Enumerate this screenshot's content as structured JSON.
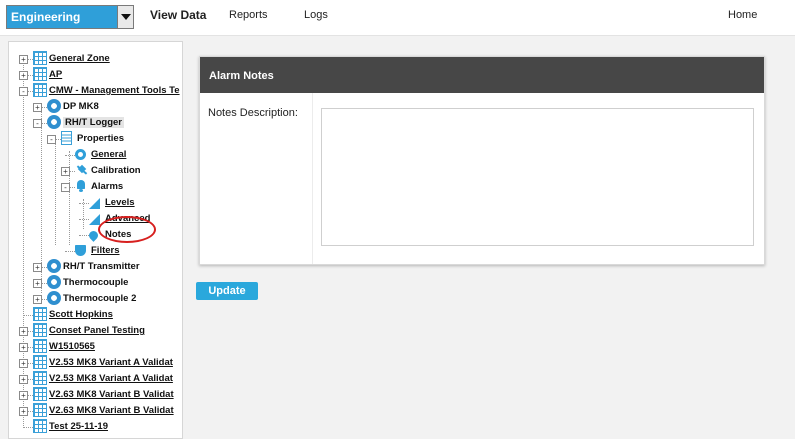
{
  "header": {
    "department_select": "Engineering",
    "nav": [
      "View Data",
      "Reports",
      "Logs"
    ],
    "home": "Home"
  },
  "tree": [
    {
      "label": "General Zone",
      "icon": "grid-icon"
    },
    {
      "label": "AP",
      "icon": "grid-icon"
    },
    {
      "label": "CMW - Management Tools Te",
      "icon": "grid-icon"
    },
    {
      "label": "DP MK8",
      "icon": "gear-icon"
    },
    {
      "label": "RH/T Logger",
      "icon": "gear-icon"
    },
    {
      "label": "Properties",
      "icon": "page-icon"
    },
    {
      "label": "General",
      "icon": "ring-icon"
    },
    {
      "label": "Calibration",
      "icon": "satellite-icon"
    },
    {
      "label": "Alarms",
      "icon": "bell-icon"
    },
    {
      "label": "Levels",
      "icon": "triangle-icon"
    },
    {
      "label": "Advanced",
      "icon": "triangle-icon"
    },
    {
      "label": "Notes",
      "icon": "drop-icon"
    },
    {
      "label": "Filters",
      "icon": "shield-icon"
    },
    {
      "label": "RH/T Transmitter",
      "icon": "gear-icon"
    },
    {
      "label": "Thermocouple",
      "icon": "gear-icon"
    },
    {
      "label": "Thermocouple 2",
      "icon": "gear-icon"
    },
    {
      "label": "Scott Hopkins",
      "icon": "grid-icon"
    },
    {
      "label": "Conset Panel Testing",
      "icon": "grid-icon"
    },
    {
      "label": "W1510565",
      "icon": "grid-icon"
    },
    {
      "label": "V2.53 MK8 Variant A Validat",
      "icon": "grid-icon"
    },
    {
      "label": "V2.53 MK8 Variant A Validat",
      "icon": "grid-icon"
    },
    {
      "label": "V2.63 MK8 Variant B Validat",
      "icon": "grid-icon"
    },
    {
      "label": "V2.63 MK8 Variant B Validat",
      "icon": "grid-icon"
    },
    {
      "label": "Test 25-11-19",
      "icon": "grid-icon"
    }
  ],
  "panel": {
    "title": "Alarm Notes",
    "notes_label": "Notes Description:",
    "notes_value": ""
  },
  "update_label": "Update",
  "colors": {
    "accent": "#2aa8dc",
    "panel_header": "#474747",
    "highlight": "#d7201f"
  }
}
